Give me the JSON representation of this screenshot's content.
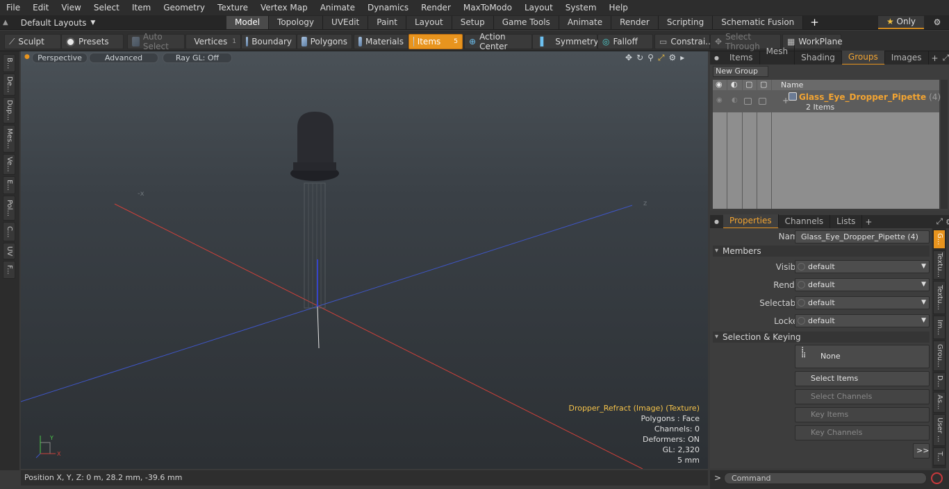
{
  "menu": [
    "File",
    "Edit",
    "View",
    "Select",
    "Item",
    "Geometry",
    "Texture",
    "Vertex Map",
    "Animate",
    "Dynamics",
    "Render",
    "MaxToModo",
    "Layout",
    "System",
    "Help"
  ],
  "layout_selector": "Default Layouts",
  "tabs": [
    "Model",
    "Topology",
    "UVEdit",
    "Paint",
    "Layout",
    "Setup",
    "Game Tools",
    "Animate",
    "Render",
    "Scripting",
    "Schematic Fusion"
  ],
  "active_tab": "Model",
  "only_label": "Only",
  "toolbar": {
    "sculpt": "Sculpt",
    "presets": "Presets",
    "auto_select": "Auto Select",
    "vertices": "Vertices",
    "vertices_count": "1",
    "boundary": "Boundary",
    "polygons": "Polygons",
    "materials": "Materials",
    "items": "Items",
    "items_count": "5",
    "action_center": "Action Center",
    "symmetry": "Symmetry",
    "falloff": "Falloff",
    "constraints": "Constrai...",
    "select_through": "Select Through",
    "workplane": "WorkPlane"
  },
  "left_tabs": [
    "B...",
    "De...",
    "Dup...",
    "Mes...",
    "Ve...",
    "E...",
    "Pol...",
    "C...",
    "UV",
    "F..."
  ],
  "viewport": {
    "perspective": "Perspective",
    "advanced": "Advanced",
    "raygl": "Ray GL: Off",
    "hud_texture": "Dropper_Refract (Image) (Texture)",
    "hud_polygons": "Polygons : Face",
    "hud_channels": "Channels: 0",
    "hud_deformers": "Deformers: ON",
    "hud_gl": "GL: 2,320",
    "hud_scale": "5 mm"
  },
  "status": {
    "position": "Position X, Y, Z:   0 m, 28.2 mm, -39.6 mm"
  },
  "right_tabs": [
    "Items",
    "Mesh ...",
    "Shading",
    "Groups",
    "Images"
  ],
  "active_right_tab": "Groups",
  "groups": {
    "new_group": "New Group",
    "name_header": "Name",
    "group_name": "Glass_Eye_Dropper_Pipette",
    "group_count": "(4)",
    "group_items": "2 Items"
  },
  "prop_tabs": [
    "Properties",
    "Channels",
    "Lists"
  ],
  "active_prop_tab": "Properties",
  "properties": {
    "name_label": "Name",
    "name_value": "Glass_Eye_Dropper_Pipette (4)",
    "members_label": "Members",
    "visible_label": "Visible",
    "visible_value": "default",
    "render_label": "Render",
    "render_value": "default",
    "selectable_label": "Selectable",
    "selectable_value": "default",
    "locked_label": "Locked",
    "locked_value": "default",
    "sel_keying_label": "Selection & Keying",
    "none_label": "None",
    "select_items": "Select Items",
    "select_channels": "Select Channels",
    "key_items": "Key Items",
    "key_channels": "Key Channels",
    "more": ">>"
  },
  "right_vtabs": [
    "G...",
    "Textu...",
    "Textu...",
    "Im...",
    "Grou...",
    "D...",
    "As...",
    "User ...",
    "T..."
  ],
  "command_placeholder": "Command",
  "colors": {
    "accent": "#e8941e",
    "active_text": "#f2a432",
    "hud_highlight": "#f5c34a"
  }
}
